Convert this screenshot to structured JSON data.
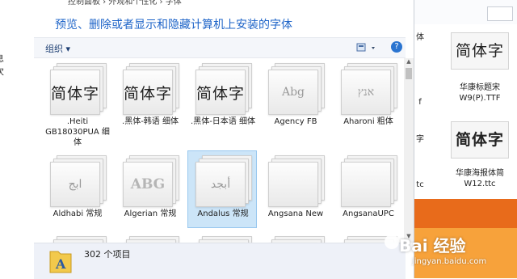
{
  "left_pane": {
    "labels": [
      "息",
      "次"
    ]
  },
  "breadcrumb": {
    "text": "控制面板 › 外观和个性化 › 字体"
  },
  "main": {
    "header_title": "预览、删除或者显示和隐藏计算机上安装的字体",
    "toolbar": {
      "organize_label": "组织 ▾",
      "view_label": "▾",
      "help_label": "?"
    },
    "fonts": [
      {
        "name": ".Heiti GB18030PUA 细体",
        "sample": "简体字",
        "style": "cn",
        "selected": false
      },
      {
        "name": ".黑体-韩语 细体",
        "sample": "简体字",
        "style": "cn",
        "selected": false
      },
      {
        "name": ".黑体-日本语 细体",
        "sample": "简体字",
        "style": "cn",
        "selected": false
      },
      {
        "name": "Agency FB",
        "sample": "Abg",
        "style": "faint",
        "selected": false
      },
      {
        "name": "Aharoni 粗体",
        "sample": "אנץ",
        "style": "faint",
        "selected": false
      },
      {
        "name": "Aldhabi 常规",
        "sample": "ابج",
        "style": "faint",
        "selected": false
      },
      {
        "name": "Algerian 常规",
        "sample": "ABG",
        "style": "bold",
        "selected": false
      },
      {
        "name": "Andalus 常规",
        "sample": "أبجد",
        "style": "faint",
        "selected": true
      },
      {
        "name": "Angsana New",
        "sample": "",
        "style": "faint",
        "selected": false
      },
      {
        "name": "AngsanaUPC",
        "sample": "",
        "style": "faint",
        "selected": false
      }
    ],
    "status": {
      "count": "302 个项目"
    }
  },
  "right_window": {
    "tiles": [
      {
        "name": "华康标题宋 W9(P).TTF",
        "sample": "简体字"
      },
      {
        "name": "华康海报体简 W12.ttc",
        "sample": "简体字"
      }
    ],
    "partial_labels": [
      "体",
      "f",
      "字",
      "tc"
    ]
  },
  "watermark": {
    "text": "Bai 经验",
    "url": "jingyan.baidu.com"
  },
  "colors": {
    "accent": "#1e64c8",
    "selection": "#cce5f8",
    "status_bg": "#eef1f8",
    "orange": "#e86b1b"
  }
}
